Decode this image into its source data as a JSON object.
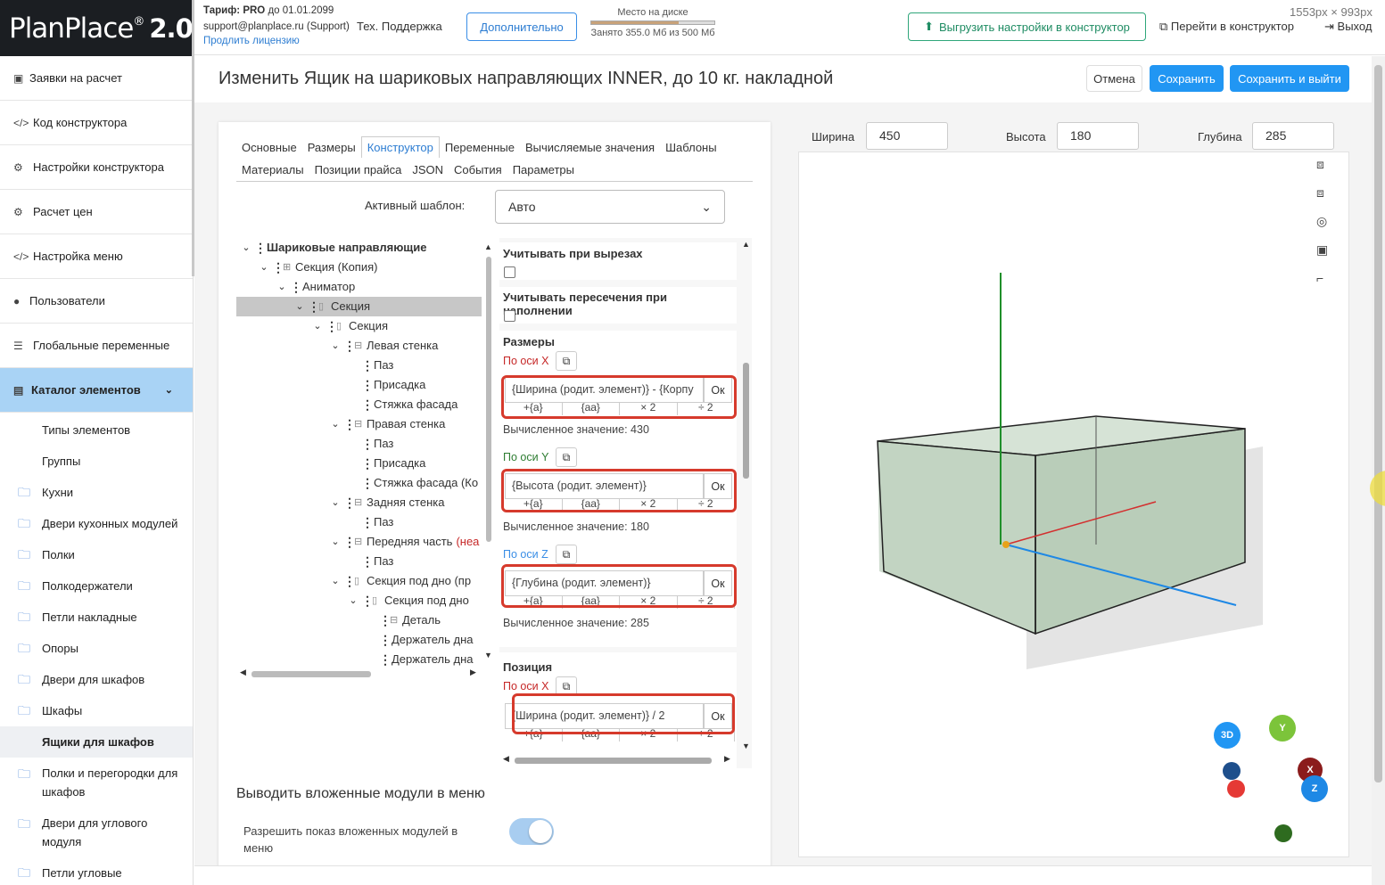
{
  "logo": {
    "main": "PlanPlace",
    "version": "2.0"
  },
  "sidebar": {
    "items": [
      {
        "label": "Заявки на расчет",
        "icon": "clipboard-icon"
      },
      {
        "label": "Код конструктора",
        "icon": "code-icon"
      },
      {
        "label": "Настройки конструктора",
        "icon": "gears-icon"
      },
      {
        "label": "Расчет цен",
        "icon": "gears-icon"
      },
      {
        "label": "Настройка меню",
        "icon": "code-icon"
      },
      {
        "label": "Пользователи",
        "icon": "user-icon"
      },
      {
        "label": "Глобальные переменные",
        "icon": "list-icon"
      },
      {
        "label": "Каталог элементов",
        "icon": "book-icon"
      }
    ],
    "sub_items": [
      "Типы элементов",
      "Группы"
    ],
    "folders": [
      "Кухни",
      "Двери кухонных модулей",
      "Полки",
      "Полкодержатели",
      "Петли накладные",
      "Опоры",
      "Двери для шкафов",
      "Шкафы",
      "Ящики для шкафов",
      "Полки и перегородки для шкафов",
      "Двери для углового модуля",
      "Петли угловые"
    ]
  },
  "topbar": {
    "tariff_label": "Тариф:",
    "tariff": "PRO",
    "until": "до 01.01.2099",
    "email": "support@planplace.ru (Support)",
    "support_name": "Тех. Поддержка",
    "extend_link": "Продлить лицензию",
    "more_button": "Дополнительно",
    "disk_title": "Место на диске",
    "disk_used": "Занято 355.0 Мб из 500 Мб",
    "disk_fraction": 0.71,
    "upload_button": "Выгрузить настройки в конструктор",
    "goto_link": "Перейти в конструктор",
    "logout": "Выход",
    "size_badge": "1553px × 993px"
  },
  "page": {
    "title": "Изменить Ящик на шариковых направляющих INNER, до 10 кг. накладной",
    "cancel": "Отмена",
    "save": "Сохранить",
    "save_exit": "Сохранить и выйти"
  },
  "tabs": {
    "row1": [
      "Основные",
      "Размеры",
      "Конструктор",
      "Переменные",
      "Вычисляемые значения",
      "Шаблоны"
    ],
    "row2": [
      "Материалы",
      "Позиции прайса",
      "JSON",
      "События",
      "Параметры"
    ],
    "active": "Конструктор"
  },
  "template": {
    "label": "Активный шаблон:",
    "value": "Авто"
  },
  "tree": [
    {
      "label": "Шариковые направляющие",
      "depth": 0,
      "chev": true,
      "box": "",
      "bold": true
    },
    {
      "label": "Секция (Копия)",
      "depth": 1,
      "chev": true,
      "box": "⊞"
    },
    {
      "label": "Аниматор",
      "depth": 2,
      "chev": true,
      "box": ""
    },
    {
      "label": "Секция",
      "depth": 3,
      "chev": true,
      "box": "▯",
      "selected": true
    },
    {
      "label": "Секция",
      "depth": 4,
      "chev": true,
      "box": "▯"
    },
    {
      "label": "Левая стенка",
      "depth": 5,
      "chev": true,
      "box": "⊟"
    },
    {
      "label": "Паз",
      "depth": 6,
      "chev": false,
      "box": ""
    },
    {
      "label": "Присадка",
      "depth": 6,
      "chev": false,
      "box": ""
    },
    {
      "label": "Стяжка фасада",
      "depth": 6,
      "chev": false,
      "box": ""
    },
    {
      "label": "Правая стенка",
      "depth": 5,
      "chev": true,
      "box": "⊟"
    },
    {
      "label": "Паз",
      "depth": 6,
      "chev": false,
      "box": ""
    },
    {
      "label": "Присадка",
      "depth": 6,
      "chev": false,
      "box": ""
    },
    {
      "label": "Стяжка фасада (Ко",
      "depth": 6,
      "chev": false,
      "box": ""
    },
    {
      "label": "Задняя стенка",
      "depth": 5,
      "chev": true,
      "box": "⊟"
    },
    {
      "label": "Паз",
      "depth": 6,
      "chev": false,
      "box": ""
    },
    {
      "label": "Передняя часть",
      "depth": 5,
      "chev": true,
      "box": "⊟",
      "suffix": "(неа"
    },
    {
      "label": "Паз",
      "depth": 6,
      "chev": false,
      "box": ""
    },
    {
      "label": "Секция под дно (пр",
      "depth": 5,
      "chev": true,
      "box": "▯"
    },
    {
      "label": "Секция под дно",
      "depth": 6,
      "chev": true,
      "box": "▯"
    },
    {
      "label": "Деталь",
      "depth": 7,
      "chev": false,
      "box": "⊟"
    },
    {
      "label": "Держатель дна",
      "depth": 7,
      "chev": false,
      "box": ""
    },
    {
      "label": "Держатель дна",
      "depth": 7,
      "chev": false,
      "box": ""
    }
  ],
  "props": {
    "cut_label": "Учитывать при вырезах",
    "cross_label": "Учитывать пересечения при наполнении",
    "sizes_title": "Размеры",
    "axis_x": "По оси X",
    "axis_y": "По оси Y",
    "axis_z": "По оси Z",
    "formula_x": "{Ширина (родит. элемент)} - {Корпу",
    "formula_y": "{Высота (родит. элемент)}",
    "formula_z": "{Глубина (родит. элемент)}",
    "ok": "Ок",
    "ops": [
      "+{a}",
      "{aa}",
      "× 2",
      "÷ 2"
    ],
    "calc_x": "Вычисленное значение: 430",
    "calc_y": "Вычисленное значение: 180",
    "calc_z": "Вычисленное значение: 285",
    "pos_title": "Позиция",
    "pos_axis_x": "По оси X",
    "pos_formula_x": "{Ширина (родит. элемент)} / 2"
  },
  "nested": {
    "title": "Выводить вложенные модули в меню",
    "allow": "Разрешить показ вложенных модулей в меню"
  },
  "dims": {
    "width_label": "Ширина",
    "width": "450",
    "height_label": "Высота",
    "height": "180",
    "depth_label": "Глубина",
    "depth": "285"
  },
  "nav": {
    "mode": "3D",
    "y": "Y",
    "x": "X",
    "z": "Z"
  },
  "colors": {
    "accent": "#2196f3",
    "highlight": "#d63a2c",
    "axis_x": "#d32f2f",
    "axis_y": "#43a047",
    "axis_z": "#1e88e5"
  }
}
